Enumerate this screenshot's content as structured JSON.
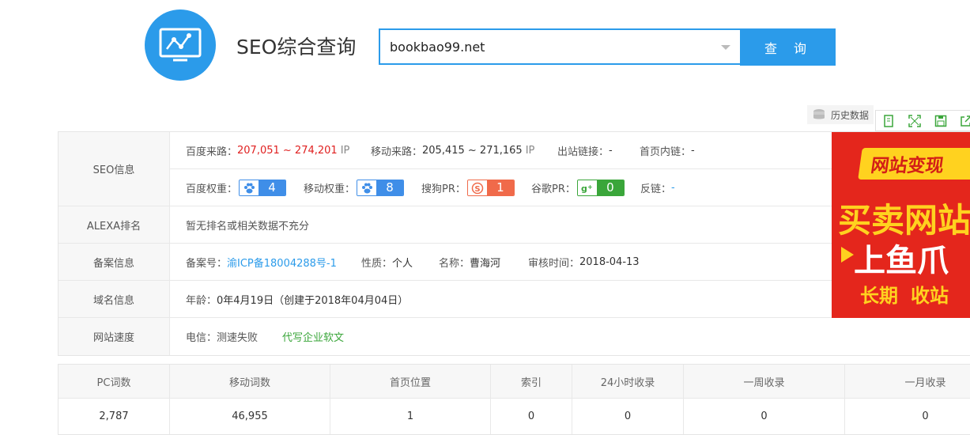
{
  "header": {
    "title": "SEO综合查询",
    "search_value": "bookbao99.net",
    "search_button": "查 询"
  },
  "toolbar": {
    "history_label": "历史数据",
    "icons": [
      "copy-icon",
      "expand-icon",
      "save-icon",
      "share-icon"
    ]
  },
  "seo": {
    "label": "SEO信息",
    "baidu_traffic_label": "百度来路：",
    "baidu_traffic_value": "207,051 ~ 274,201",
    "baidu_traffic_unit": "IP",
    "mobile_traffic_label": "移动来路：",
    "mobile_traffic_value": "205,415 ~ 271,165",
    "mobile_traffic_unit": "IP",
    "outlinks_label": "出站链接：",
    "outlinks_value": "-",
    "homepage_links_label": "首页内链：",
    "homepage_links_value": "-",
    "baidu_weight_label": "百度权重：",
    "baidu_weight_value": "4",
    "mobile_weight_label": "移动权重：",
    "mobile_weight_value": "8",
    "sogou_pr_label": "搜狗PR：",
    "sogou_pr_value": "1",
    "google_pr_label": "谷歌PR：",
    "google_pr_value": "0",
    "backlinks_label": "反链：",
    "backlinks_value": "-"
  },
  "alexa": {
    "label": "ALEXA排名",
    "value": "暂无排名或相关数据不充分"
  },
  "beian": {
    "label": "备案信息",
    "number_label": "备案号：",
    "number_value": "渝ICP备18004288号-1",
    "nature_label": "性质：",
    "nature_value": "个人",
    "name_label": "名称：",
    "name_value": "曹海河",
    "review_label": "审核时间：",
    "review_value": "2018-04-13"
  },
  "domain": {
    "label": "域名信息",
    "age_label": "年龄：",
    "age_value": "0年4月19日（创建于2018年04月04日）"
  },
  "speed": {
    "label": "网站速度",
    "telecom_label": "电信：",
    "telecom_value": "测速失败",
    "ad_link": "代写企业软文"
  },
  "ad": {
    "top": "网站变现",
    "middle": "买卖网站",
    "big": "上鱼爪",
    "bottom_left": "长期",
    "bottom_right": "收站"
  },
  "stats": {
    "headers": [
      "PC词数",
      "移动词数",
      "首页位置",
      "索引",
      "24小时收录",
      "一周收录",
      "一月收录"
    ],
    "values": [
      "2,787",
      "46,955",
      "1",
      "0",
      "0",
      "0",
      "0"
    ]
  },
  "colors": {
    "accent": "#2b9bea",
    "red": "#e02020",
    "green": "#3aa63a",
    "ad_red": "#e4261c",
    "ad_yellow": "#ffd21f"
  }
}
